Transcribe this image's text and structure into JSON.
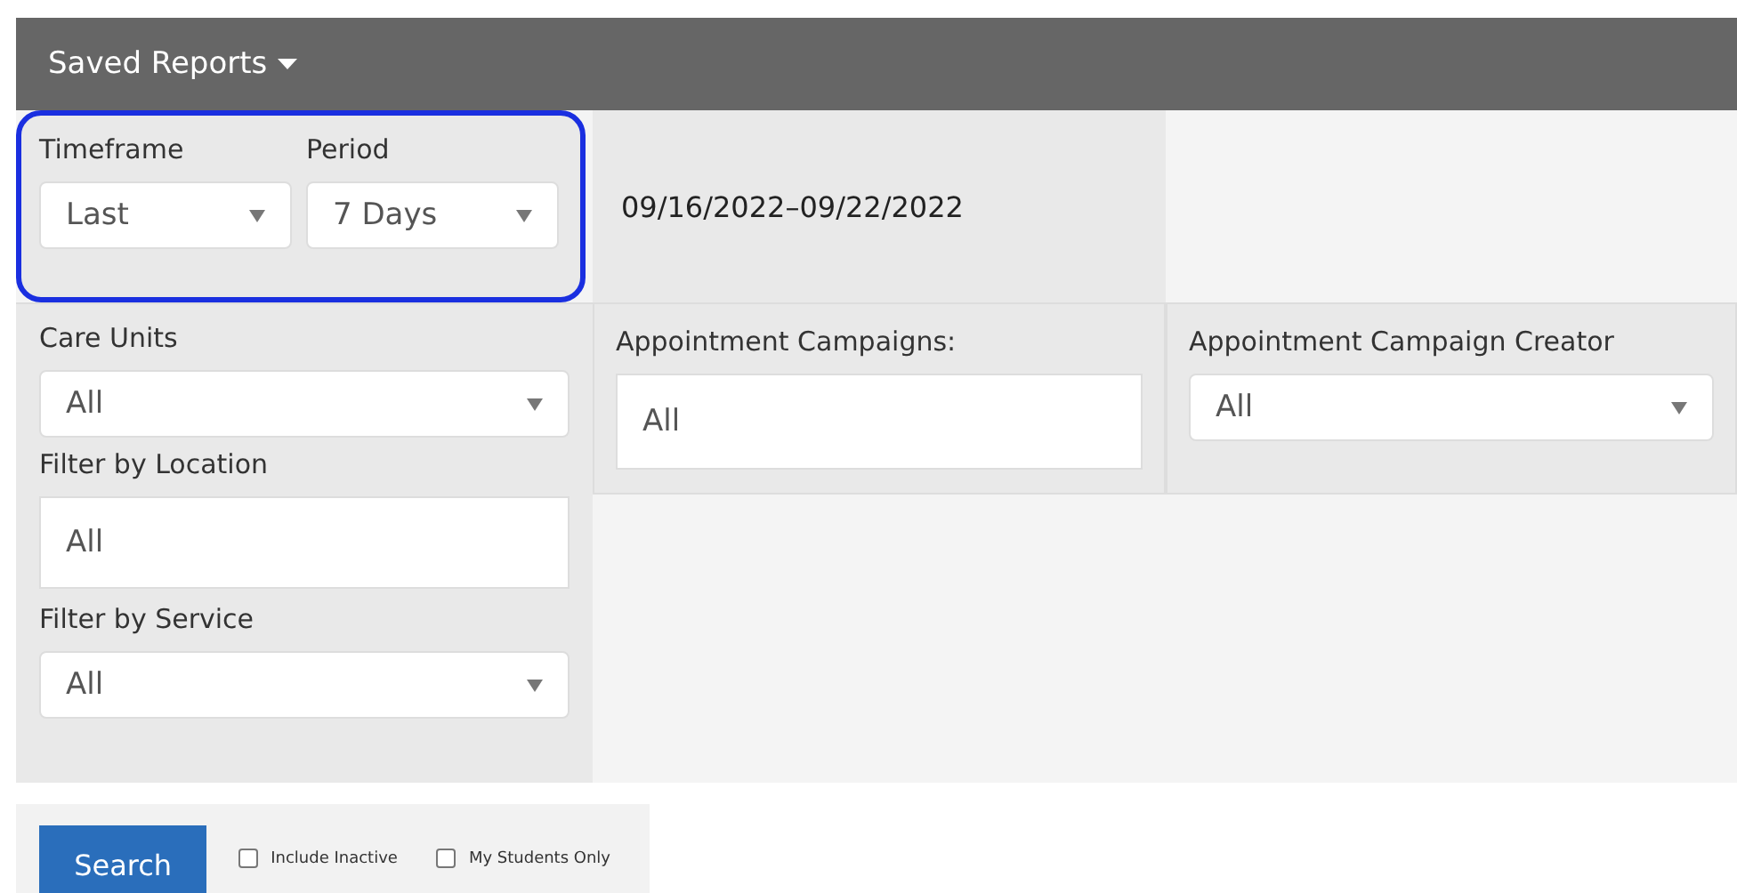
{
  "header": {
    "title": "Saved Reports"
  },
  "timeframe": {
    "fields": [
      {
        "label": "Timeframe",
        "value": "Last"
      },
      {
        "label": "Period",
        "value": "7 Days"
      }
    ],
    "highlighted": true
  },
  "date_range": "09/16/2022–09/22/2022",
  "filters_left": [
    {
      "label": "Care Units",
      "value": "All",
      "kind": "select"
    },
    {
      "label": "Filter by Location",
      "value": "All",
      "kind": "text"
    },
    {
      "label": "Filter by Service",
      "value": "All",
      "kind": "select"
    }
  ],
  "campaigns": {
    "label": "Appointment Campaigns:",
    "value": "All"
  },
  "creator": {
    "label": "Appointment Campaign Creator",
    "value": "All"
  },
  "actions": {
    "button": "Search",
    "options": [
      {
        "label": "Include Inactive",
        "checked": false
      },
      {
        "label": "My Students Only",
        "checked": false
      }
    ]
  }
}
